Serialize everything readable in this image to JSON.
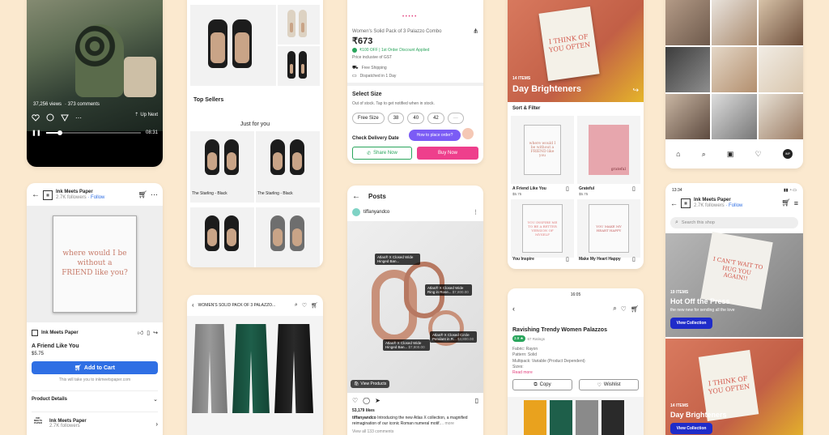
{
  "colors": {
    "background": "#fbe9cf",
    "accent_blue": "#2f6fe4",
    "accent_pink": "#ee3f8c",
    "whatsapp_green": "#2aa55c"
  },
  "reel": {
    "views": "37,256 views",
    "comments": "· 373 comments",
    "next_label": "Up Next",
    "time": "08:31",
    "progress": 0.15
  },
  "shop_product": {
    "shop_name": "Ink Meets Paper",
    "followers": "2.7K followers",
    "follow": "· Follow",
    "card_text": "where would I be without a FRIEND like you?",
    "seller_name": "Ink Meets Paper",
    "product_title": "A Friend Like You",
    "price": "$5.75",
    "add_to_cart": "Add to Cart",
    "link_note": "This will take you to inkmeetspaper.com",
    "details_label": "Product Details",
    "footer_name": "Ink Meets Paper",
    "footer_followers": "2.7K followers",
    "footer_logo": "INK MEETS PAPER"
  },
  "shoes_grid": {
    "top_sellers": "Top Sellers",
    "just_for_you": "Just for you",
    "items": [
      {
        "name": "The Starling - Black"
      },
      {
        "name": "The Starling - Black"
      }
    ]
  },
  "palazzo_list": {
    "title": "WOMEN'S SOLID PACK OF 3 PALAZZO..."
  },
  "palazzo_detail": {
    "title": "Women's Solid Pack of 3 Palazzo Combo",
    "price": "₹673",
    "offer": "₹100 OFF | 1st Order Discount Applied",
    "gst": "Price inclusive of GST",
    "shipping": "Free Shipping",
    "dispatch": "Dispatched in 1 Day",
    "select_size": "Select Size",
    "stock_note": "Out of stock. Tap to get notified when in stock.",
    "sizes": [
      "Free Size",
      "38",
      "40",
      "42",
      "—"
    ],
    "delivery": "Check Delivery Date",
    "chat": "How to place order?",
    "share": "Share Now",
    "buy": "Buy Now"
  },
  "posts": {
    "header": "Posts",
    "account": "tiffanyandco",
    "tags": [
      "Atlas® X Closed Wide Hinged Ban...",
      "Atlas® X Closed Wide Ring in Rose...",
      "Atlas® X Closed Wide Hinged Ban...",
      "Atlas® X Closed Circle Pendant in R..."
    ],
    "tag_prices": [
      "",
      "$7,800.00",
      "$7,800.00",
      "$3,800.00"
    ],
    "view_products": "View Products",
    "likes": "53,179 likes",
    "caption_user": "tiffanyandco",
    "caption": "Introducing the new Atlas X collection, a magnified reimagination of our iconic Roman numeral motif.",
    "more": "... more",
    "view_comments": "View all 133 comments"
  },
  "palazzo_meesho": {
    "time": "16:05",
    "title": "Ravishing Trendy Women Palazzos",
    "rating": "3.9 ★",
    "ratings_count": "67 Ratings",
    "specs": [
      "Fabric: Rayon",
      "Pattern: Solid",
      "Multipack: Variable (Product Dependent)",
      "Sizes:"
    ],
    "read_more": "Read more",
    "copy": "Copy",
    "wishlist": "Wishlist"
  },
  "collection": {
    "count": "14 ITEMS",
    "title": "Day Brighteners",
    "card_text": "I THINK OF YOU OFTEN",
    "sort_filter": "Sort & Filter",
    "items": [
      {
        "name": "A Friend Like You",
        "price": "$5.75",
        "card": "where would I be without a FRIEND like you"
      },
      {
        "name": "Grateful",
        "price": "$5.75",
        "card": "grateful"
      },
      {
        "name": "You Inspire",
        "price": "$5.75",
        "card": "YOU INSPIRE ME TO BE A BETTER VERSION OF MYSELF"
      },
      {
        "name": "Make My Heart Happy",
        "price": "$5.75",
        "card": "YOU MAKE MY HEART HAPPY"
      }
    ]
  },
  "profile_grid": {
    "avatar": "IMP"
  },
  "shop_home": {
    "time": "13:34",
    "shop_name": "Ink Meets Paper",
    "followers": "2.7K followers",
    "follow": "· Follow",
    "search_placeholder": "Search this shop",
    "card_text": "I CAN'T WAIT TO HUG YOU AGAIN!!",
    "count1": "19 ITEMS",
    "title1": "Hot Off the Press",
    "sub1": "the new new for sending all the love",
    "view1": "View Collection",
    "count2": "14 ITEMS",
    "title2": "Day Brighteners",
    "card2": "I THINK OF YOU OFTEN",
    "view2": "View Collection"
  }
}
